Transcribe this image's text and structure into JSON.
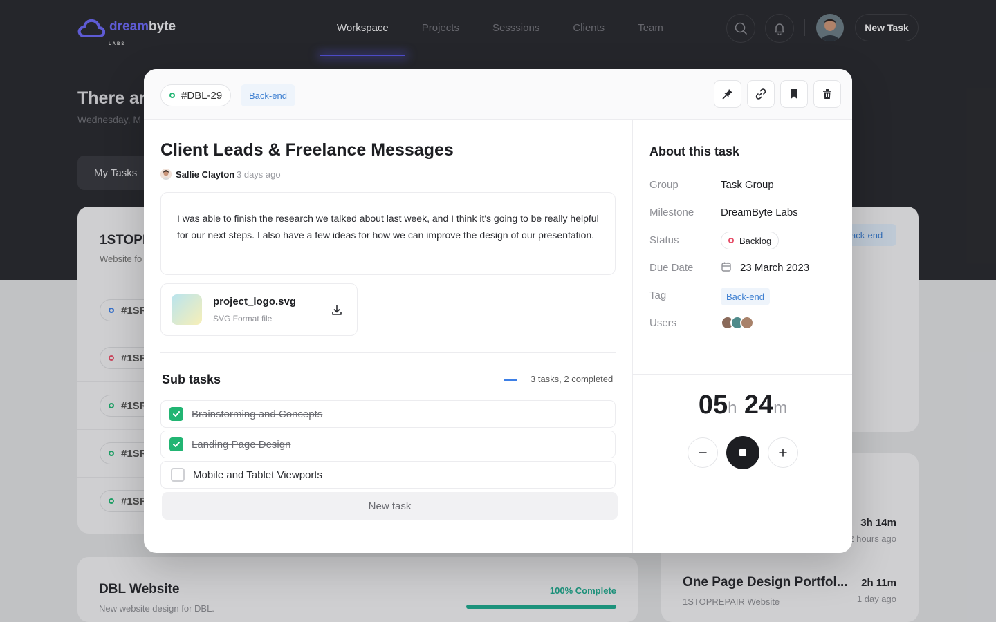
{
  "app": {
    "logo_primary": "dream",
    "logo_secondary": "byte",
    "logo_sub": "LABS"
  },
  "nav": {
    "items": [
      "Workspace",
      "Projects",
      "Sesssions",
      "Clients",
      "Team"
    ],
    "active": "Workspace",
    "new_task_label": "New Task"
  },
  "background": {
    "greeting": "There ar",
    "date": "Wednesday, M",
    "my_tasks": "My Tasks",
    "card1": {
      "title": "1STOPR",
      "subtitle": "Website fo",
      "row_ids": [
        "#1SR",
        "#1SR",
        "#1SR",
        "#1SR",
        "#1SR"
      ],
      "tag": "ack-end"
    },
    "card_dbl": {
      "title": "DBL Website",
      "subtitle": "New website design for DBL.",
      "progress_label": "100% Complete",
      "progress": 1.0
    },
    "items": [
      {
        "title": "",
        "subtitle": "",
        "time": "3h 14m",
        "ago": "2 hours ago"
      },
      {
        "title": "One Page Design Portfol...",
        "subtitle": "1STOPREPAIR Website",
        "time": "2h 11m",
        "ago": "1 day ago"
      }
    ]
  },
  "modal": {
    "task_id": "#DBL-29",
    "tag": "Back-end",
    "actions": [
      "pin-icon",
      "link-icon",
      "bookmark-icon",
      "trash-icon"
    ],
    "title": "Client Leads & Freelance Messages",
    "author": "Sallie Clayton",
    "time_ago": "3 days ago",
    "description": "I was able to finish the research we talked about last week, and I think it's going to be really helpful for our next steps. I also have a few ideas for how we can improve the design of our presentation.",
    "attachment": {
      "name": "project_logo.svg",
      "type": "SVG Format file"
    },
    "subtasks": {
      "title": "Sub tasks",
      "summary": "3  tasks, 2 completed",
      "items": [
        {
          "label": "Brainstorming and Concepts",
          "done": true
        },
        {
          "label": "Landing Page Design",
          "done": true
        },
        {
          "label": "Mobile and Tablet Viewports",
          "done": false
        }
      ],
      "new_task_label": "New task"
    },
    "about": {
      "title": "About this task",
      "group_label": "Group",
      "group": "Task Group",
      "milestone_label": "Milestone",
      "milestone": "DreamByte Labs",
      "status_label": "Status",
      "status": "Backlog",
      "due_label": "Due Date",
      "due": "23 March 2023",
      "tag_label": "Tag",
      "tag": "Back-end",
      "users_label": "Users"
    },
    "timer": {
      "hours": "05",
      "hours_unit": "h",
      "minutes": "24",
      "minutes_unit": "m"
    }
  },
  "colors": {
    "accent": "#5b58e6",
    "success": "#22b573",
    "danger": "#e6506a",
    "info": "#3d7fd1",
    "dark": "#2b2c31"
  }
}
